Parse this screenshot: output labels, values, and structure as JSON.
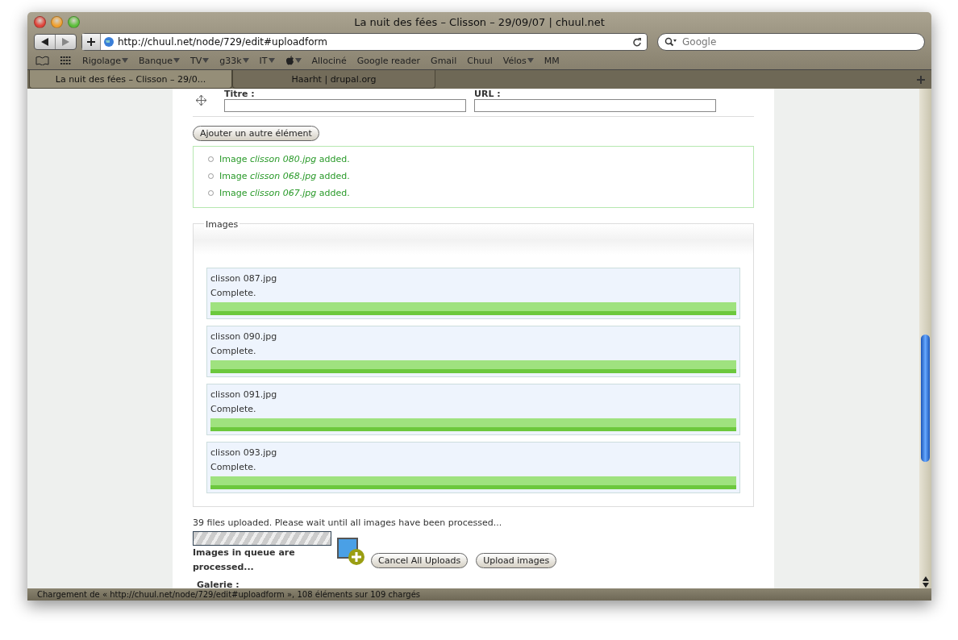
{
  "window": {
    "title": "La nuit des fées – Clisson – 29/09/07 | chuul.net"
  },
  "toolbar": {
    "url": "http://chuul.net/node/729/edit#uploadform",
    "search": {
      "placeholder": "Google"
    }
  },
  "bookmarks": [
    {
      "label": "Rigolage",
      "menu": true
    },
    {
      "label": "Banque",
      "menu": true
    },
    {
      "label": "TV",
      "menu": true
    },
    {
      "label": "g33k",
      "menu": true
    },
    {
      "label": "IT",
      "menu": true
    },
    {
      "kind": "apple",
      "menu": true
    },
    {
      "label": "Allociné",
      "menu": false
    },
    {
      "label": "Google reader",
      "menu": false
    },
    {
      "label": "Gmail",
      "menu": false
    },
    {
      "label": "Chuul",
      "menu": false
    },
    {
      "label": "Vélos",
      "menu": true
    },
    {
      "label": "MM",
      "menu": false
    }
  ],
  "tabs": [
    {
      "label": "La nuit des fées – Clisson – 29/0...",
      "selected": true
    },
    {
      "label": "Haarht | drupal.org",
      "selected": false
    }
  ],
  "link_row": {
    "title_label": "Titre :",
    "url_label": "URL :"
  },
  "add_button": "Ajouter un autre élément",
  "messages": [
    "Image *clisson 080.jpg* added.",
    "Image *clisson 068.jpg* added.",
    "Image *clisson 067.jpg* added."
  ],
  "images_fieldset": {
    "legend": "Images",
    "uploads": [
      {
        "name": "clisson 087.jpg",
        "status": "Complete.",
        "level": 1
      },
      {
        "name": "clisson 090.jpg",
        "status": "Complete.",
        "level": 1
      },
      {
        "name": "clisson 091.jpg",
        "status": "Complete.",
        "level": 1
      },
      {
        "name": "clisson 093.jpg",
        "status": "Complete.",
        "level": 1
      }
    ]
  },
  "upload_status": "39 files uploaded. Please wait until all images have been processed...",
  "queue_bar": {
    "level": 1
  },
  "queue_label": "Images in queue are processed...",
  "buttons": [
    "Cancel All Uploads",
    "Upload images"
  ],
  "gallery_label": "Galerie :",
  "status_bar": "Chargement de « http://chuul.net/node/729/edit#uploadform », 108 éléments sur 109 chargés"
}
